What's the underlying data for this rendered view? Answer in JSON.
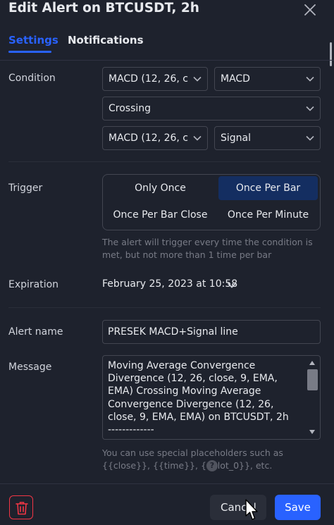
{
  "dialog": {
    "title": "Edit Alert on BTCUSDT, 2h",
    "close_icon": "close-icon"
  },
  "tabs": [
    {
      "label": "Settings",
      "active": true
    },
    {
      "label": "Notifications",
      "active": false
    }
  ],
  "condition": {
    "label": "Condition",
    "source_1": "MACD (12, 26, c...",
    "plot_1": "MACD",
    "operator": "Crossing",
    "source_2": "MACD (12, 26, c...",
    "plot_2": "Signal"
  },
  "trigger": {
    "label": "Trigger",
    "options": [
      "Only Once",
      "Once Per Bar",
      "Once Per Bar Close",
      "Once Per Minute"
    ],
    "selected": "Once Per Bar",
    "hint": "The alert will trigger every time the condition is met, but not more than 1 time per bar"
  },
  "expiration": {
    "label": "Expiration",
    "value": "February 25, 2023 at 10:58"
  },
  "alert_name": {
    "label": "Alert name",
    "value": "PRESEK MACD+Signal line"
  },
  "message": {
    "label": "Message",
    "value": "Moving Average Convergence Divergence (12, 26, close, 9, EMA, EMA) Crossing Moving Average Convergence Divergence (12, 26, close, 9, EMA, EMA) on BTCUSDT, 2h\n-------------",
    "hint": "You can use special placeholders such as {{close}}, {{time}}, {{plot_0}}, etc.",
    "help_glyph": "?"
  },
  "footer": {
    "cancel_label": "Cancel",
    "save_label": "Save"
  },
  "colors": {
    "background": "#1e222d",
    "accent": "#2962ff",
    "selected_segment": "#142e61",
    "danger": "#f23645",
    "border": "#434651",
    "muted_text": "#787b86"
  }
}
